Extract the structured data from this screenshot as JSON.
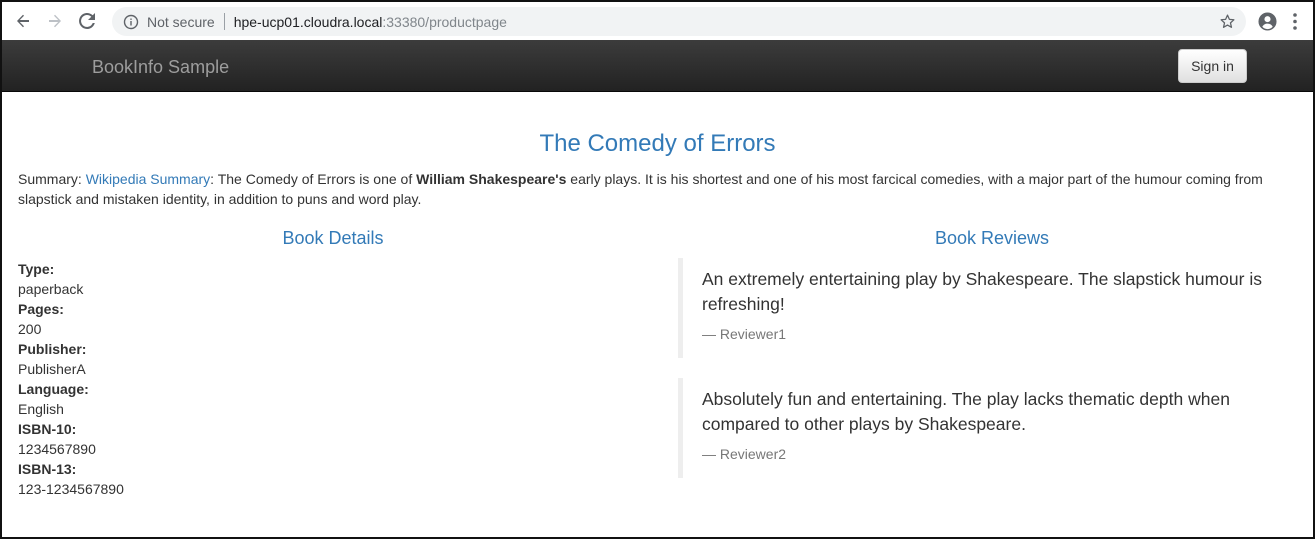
{
  "browser": {
    "security_label": "Not secure",
    "url_host": "hpe-ucp01.cloudra.local",
    "url_rest": ":33380/productpage",
    "icons": [
      "back-icon",
      "forward-icon",
      "reload-icon",
      "info-icon",
      "star-icon",
      "account-icon",
      "menu-icon"
    ]
  },
  "navbar": {
    "brand": "BookInfo Sample",
    "signin_label": "Sign in"
  },
  "product": {
    "title": "The Comedy of Errors",
    "summary_prefix": "Summary: ",
    "summary_link": "Wikipedia Summary",
    "summary_text_1": ": The Comedy of Errors is one of ",
    "summary_bold": "William Shakespeare's",
    "summary_text_2": " early plays. It is his shortest and one of his most farcical comedies, with a major part of the humour coming from slapstick and mistaken identity, in addition to puns and word play."
  },
  "details": {
    "heading": "Book Details",
    "fields": [
      {
        "label": "Type:",
        "value": "paperback"
      },
      {
        "label": "Pages:",
        "value": "200"
      },
      {
        "label": "Publisher:",
        "value": "PublisherA"
      },
      {
        "label": "Language:",
        "value": "English"
      },
      {
        "label": "ISBN-10:",
        "value": "1234567890"
      },
      {
        "label": "ISBN-13:",
        "value": "123-1234567890"
      }
    ]
  },
  "reviews": {
    "heading": "Book Reviews",
    "items": [
      {
        "text": "An extremely entertaining play by Shakespeare. The slapstick humour is refreshing!",
        "author": "— Reviewer1"
      },
      {
        "text": "Absolutely fun and entertaining. The play lacks thematic depth when compared to other plays by Shakespeare.",
        "author": "— Reviewer2"
      }
    ]
  },
  "colors": {
    "link": "#337ab7",
    "navbar": "#222222",
    "text": "#333333"
  }
}
